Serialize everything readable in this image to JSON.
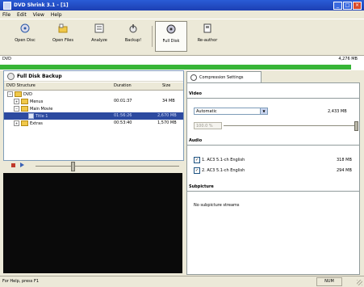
{
  "window": {
    "title": "DVD Shrink 3.1 - [1]",
    "controls": [
      "_",
      "□",
      "×"
    ]
  },
  "menu": [
    "File",
    "Edit",
    "View",
    "Help"
  ],
  "toolbar": [
    {
      "label": "Open Disc",
      "icon": "open-disc-icon"
    },
    {
      "label": "Open Files",
      "icon": "open-files-icon"
    },
    {
      "label": "Analyze",
      "icon": "analyze-icon"
    },
    {
      "label": "Backup!",
      "icon": "backup-icon"
    },
    {
      "label": "Full Disk",
      "icon": "full-disk-icon"
    },
    {
      "label": "Re-author",
      "icon": "re-author-icon"
    }
  ],
  "progress": {
    "left_label": "DVD",
    "right_label": "4,276 MB",
    "fraction": 0.965,
    "color": "#37b537"
  },
  "left_pane": {
    "header": "Full Disk Backup",
    "columns": [
      "DVD Structure",
      "Duration",
      "Size"
    ],
    "rows": [
      {
        "name": "DVD",
        "duration": "",
        "size": ""
      },
      {
        "name": "Menus",
        "duration": "00:01:37",
        "size": "34 MB"
      },
      {
        "name": "Main Movie",
        "duration": "",
        "size": ""
      },
      {
        "name": "Title 1",
        "duration": "01:56:26",
        "size": "2,670 MB"
      },
      {
        "name": "Extras",
        "duration": "00:53:40",
        "size": "1,570 MB"
      }
    ]
  },
  "right_pane": {
    "tab_label": "Compression Settings",
    "video_section": "Video",
    "compression_mode": "Automatic",
    "compression_percent": "100.0 %",
    "video_size": "2,433 MB",
    "audio_section": "Audio",
    "audio_tracks": [
      {
        "label": "1. AC3 5.1-ch English",
        "size": "318 MB"
      },
      {
        "label": "2. AC3 5.1-ch English",
        "size": "294 MB"
      }
    ],
    "subpicture_section": "Subpicture",
    "subpicture_text": "No subpicture streams"
  },
  "status": {
    "left": "For Help, press F1",
    "num": "NUM"
  }
}
